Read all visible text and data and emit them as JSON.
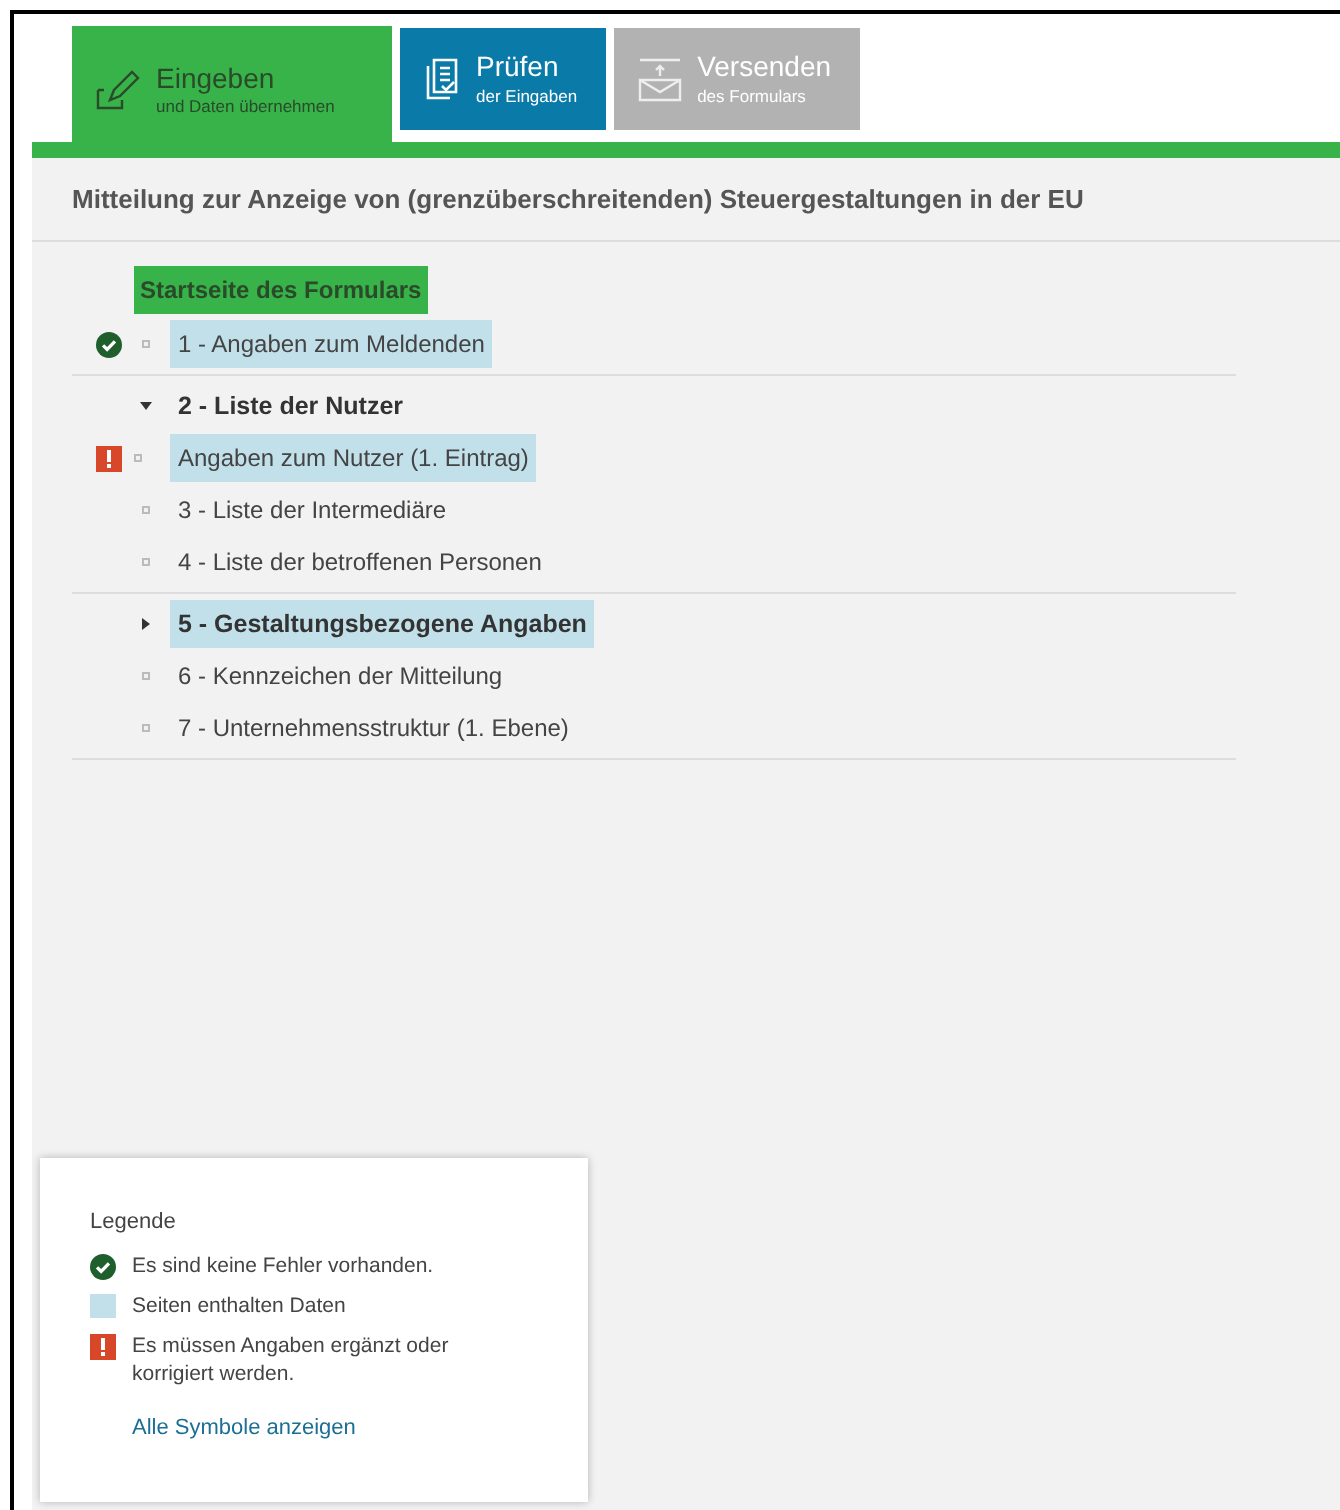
{
  "tabs": [
    {
      "kind": "enter",
      "title": "Eingeben",
      "subtitle": "und Daten übernehmen",
      "color": "#37b34a",
      "selected": true
    },
    {
      "kind": "check",
      "title": "Prüfen",
      "subtitle": "der Eingaben",
      "color": "#0a7aa8",
      "selected": false
    },
    {
      "kind": "send",
      "title": "Versenden",
      "subtitle": "des Formulars",
      "color": "#b2b2b2",
      "selected": false
    }
  ],
  "form_title": "Mitteilung zur Anzeige von (grenzüberschreitenden) Steuergestaltungen in der EU",
  "tree": {
    "start_page": "Startseite des Formulars",
    "groups": [
      {
        "items": [
          {
            "kind": "page",
            "label": "1 - Angaben zum Meldenden",
            "no_errors": true,
            "error": false,
            "has_data": true
          }
        ]
      },
      {
        "items": [
          {
            "kind": "folder",
            "label": "2 - Liste der Nutzer",
            "expanded": true,
            "has_data": false,
            "children": [
              {
                "kind": "page",
                "label": "Angaben zum Nutzer (1. Eintrag)",
                "no_errors": false,
                "error": true,
                "has_data": true
              }
            ]
          },
          {
            "kind": "page",
            "label": "3 - Liste der Intermediäre",
            "no_errors": false,
            "error": false,
            "has_data": false
          },
          {
            "kind": "page",
            "label": "4 - Liste der betroffenen Personen",
            "no_errors": false,
            "error": false,
            "has_data": false
          }
        ]
      },
      {
        "items": [
          {
            "kind": "folder",
            "label": "5 - Gestaltungsbezogene Angaben",
            "expanded": false,
            "has_data": true
          },
          {
            "kind": "page",
            "label": "6 - Kennzeichen der Mitteilung",
            "no_errors": false,
            "error": false,
            "has_data": false
          },
          {
            "kind": "page",
            "label": "7 - Unternehmensstruktur (1. Ebene)",
            "no_errors": false,
            "error": false,
            "has_data": false
          }
        ]
      }
    ]
  },
  "legend": {
    "title": "Legende",
    "entries": [
      {
        "kind": "ok",
        "text": "Es sind keine Fehler vorhanden."
      },
      {
        "kind": "data",
        "text": "Seiten enthalten Daten"
      },
      {
        "kind": "error",
        "text": "Es müssen Angaben ergänzt oder korrigiert werden."
      }
    ],
    "link": "Alle Symbole anzeigen"
  }
}
